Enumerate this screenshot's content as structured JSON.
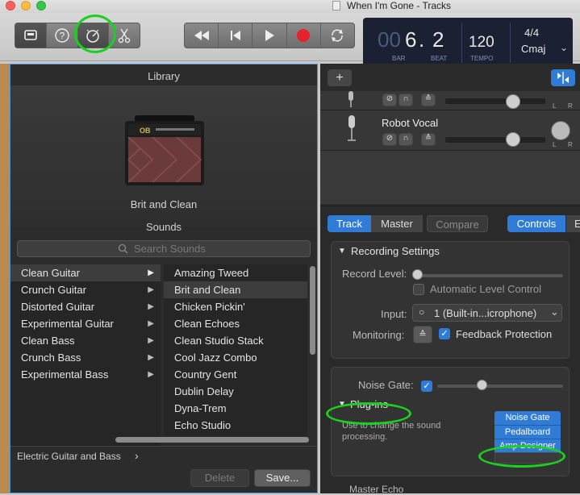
{
  "window": {
    "title": "When I'm Gone - Tracks"
  },
  "toolbar": {
    "lcd": {
      "bar": "6",
      "beat": "2",
      "tempo": "120",
      "signature": "4/4",
      "key": "Cmaj",
      "bar_label": "BAR",
      "beat_label": "BEAT",
      "tempo_label": "TEMPO",
      "bar_dim": "00",
      "dot": "."
    }
  },
  "library": {
    "title": "Library",
    "preset_name": "Brit and Clean",
    "sounds_title": "Sounds",
    "search_placeholder": "Search Sounds",
    "categories": [
      {
        "label": "Clean Guitar",
        "selected": true
      },
      {
        "label": "Crunch Guitar"
      },
      {
        "label": "Distorted Guitar"
      },
      {
        "label": "Experimental Guitar"
      },
      {
        "label": "Clean Bass"
      },
      {
        "label": "Crunch Bass"
      },
      {
        "label": "Experimental Bass"
      }
    ],
    "patches": [
      {
        "label": "Amazing Tweed"
      },
      {
        "label": "Brit and Clean",
        "selected": true
      },
      {
        "label": "Chicken Pickin'"
      },
      {
        "label": "Clean Echoes"
      },
      {
        "label": "Clean Studio Stack"
      },
      {
        "label": "Cool Jazz Combo"
      },
      {
        "label": "Country Gent"
      },
      {
        "label": "Dublin Delay"
      },
      {
        "label": "Dyna-Trem"
      },
      {
        "label": "Echo Studio"
      }
    ],
    "footer_path": "Electric Guitar and Bass",
    "footer_chevron": "›",
    "delete_label": "Delete",
    "save_label": "Save..."
  },
  "tracks": {
    "add_label": "+",
    "second_track_name": "Robot Vocal",
    "pan_L": "L",
    "pan_R": "R"
  },
  "inspector": {
    "tabs": {
      "track": "Track",
      "master": "Master",
      "compare": "Compare",
      "controls": "Controls",
      "eq": "E"
    },
    "recording": {
      "title": "Recording Settings",
      "level_label": "Record Level:",
      "auto_level_label": "Automatic Level Control",
      "input_label": "Input:",
      "input_value": "1  (Built-in...icrophone)",
      "monitoring_label": "Monitoring:",
      "feedback_label": "Feedback Protection"
    },
    "plugins": {
      "noise_gate_label": "Noise Gate:",
      "title": "Plug-ins",
      "description": "Use to change the sound processing.",
      "items": [
        "Noise Gate",
        "Pedalboard",
        "Amp Designer"
      ],
      "cut_label": "Master Echo"
    }
  },
  "colors": {
    "accent": "#2f7bd6",
    "highlight_ring": "#19d11e",
    "lcd_bg": "#1b2132"
  }
}
